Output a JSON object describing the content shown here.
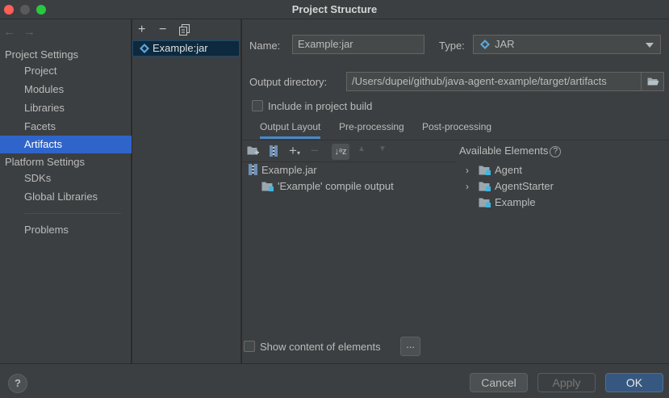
{
  "window": {
    "title": "Project Structure"
  },
  "nav": {
    "back_arrow": "←",
    "forward_arrow": "→",
    "project_settings_label": "Project Settings",
    "project_settings_items": [
      {
        "label": "Project"
      },
      {
        "label": "Modules"
      },
      {
        "label": "Libraries"
      },
      {
        "label": "Facets"
      },
      {
        "label": "Artifacts",
        "selected": true
      }
    ],
    "platform_settings_label": "Platform Settings",
    "platform_settings_items": [
      {
        "label": "SDKs"
      },
      {
        "label": "Global Libraries"
      }
    ],
    "problems_label": "Problems"
  },
  "artifacts_panel": {
    "toolbar": {
      "add": "+",
      "remove": "−",
      "copy_icon": "copy-icon"
    },
    "items": [
      {
        "label": "Example:jar",
        "icon": "jar-artifact-icon"
      }
    ]
  },
  "details": {
    "name_label": "Name:",
    "name_value": "Example:jar",
    "type_label": "Type:",
    "type_value": "JAR",
    "output_dir_label": "Output directory:",
    "output_dir_value": "/Users/dupei/github/java-agent-example/target/artifacts",
    "include_build_label": "Include in project build",
    "include_build_checked": false,
    "tabs": [
      "Output Layout",
      "Pre-processing",
      "Post-processing"
    ],
    "active_tab": "Output Layout",
    "layout_tree": [
      {
        "label": "Example.jar",
        "icon": "archive-icon"
      },
      {
        "label": "'Example' compile output",
        "icon": "folder-icon"
      }
    ],
    "available_elements_label": "Available Elements",
    "available_elements": [
      {
        "label": "Agent",
        "expandable": true
      },
      {
        "label": "AgentStarter",
        "expandable": true
      },
      {
        "label": "Example",
        "expandable": false
      }
    ],
    "show_content_label": "Show content of elements",
    "show_content_checked": false,
    "more_button_label": "..."
  },
  "footer": {
    "help": "?",
    "cancel": "Cancel",
    "apply": "Apply",
    "ok": "OK"
  },
  "colors": {
    "selection": "#2f65ca",
    "panel": "#3c3f41",
    "accent_blue": "#4a88c7",
    "ok_button": "#365880"
  }
}
